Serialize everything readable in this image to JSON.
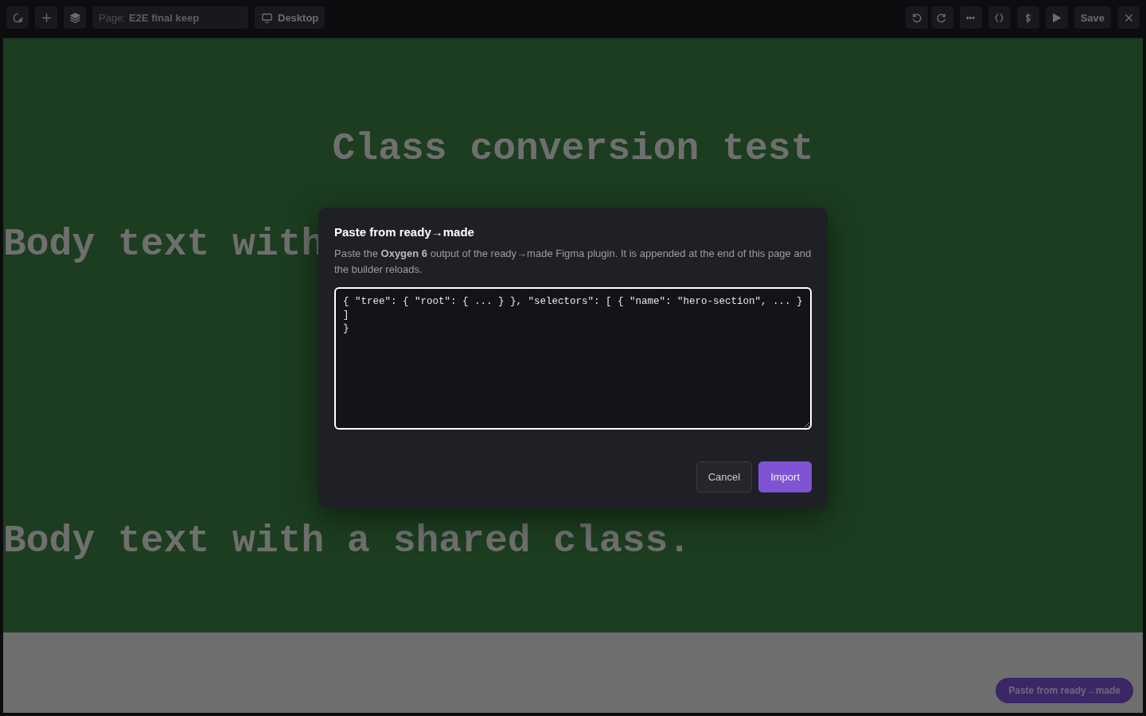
{
  "toolbar": {
    "page_field": {
      "label": "Page:",
      "value": "E2E final keep"
    },
    "device_button": "Desktop",
    "save_button": "Save"
  },
  "canvas": {
    "heading": "Class conversion test",
    "paragraphs": [
      "Body text with",
      "Body text with a shared class."
    ]
  },
  "dialog": {
    "title": "Paste from ready→made",
    "description": "Paste the **Oxygen 6** output of the ready→made Figma plugin. It is appended at the end of this page and the builder reloads.",
    "textarea": {
      "value": "{ \"tree\": { \"root\": { ... } }, \"selectors\": [ { \"name\": \"hero-section\", ... } ]\n}"
    },
    "buttons": [
      {
        "label": "Cancel",
        "kind": "secondary"
      },
      {
        "label": "Import",
        "kind": "primary"
      }
    ]
  },
  "floating_button": "Paste from ready→made"
}
